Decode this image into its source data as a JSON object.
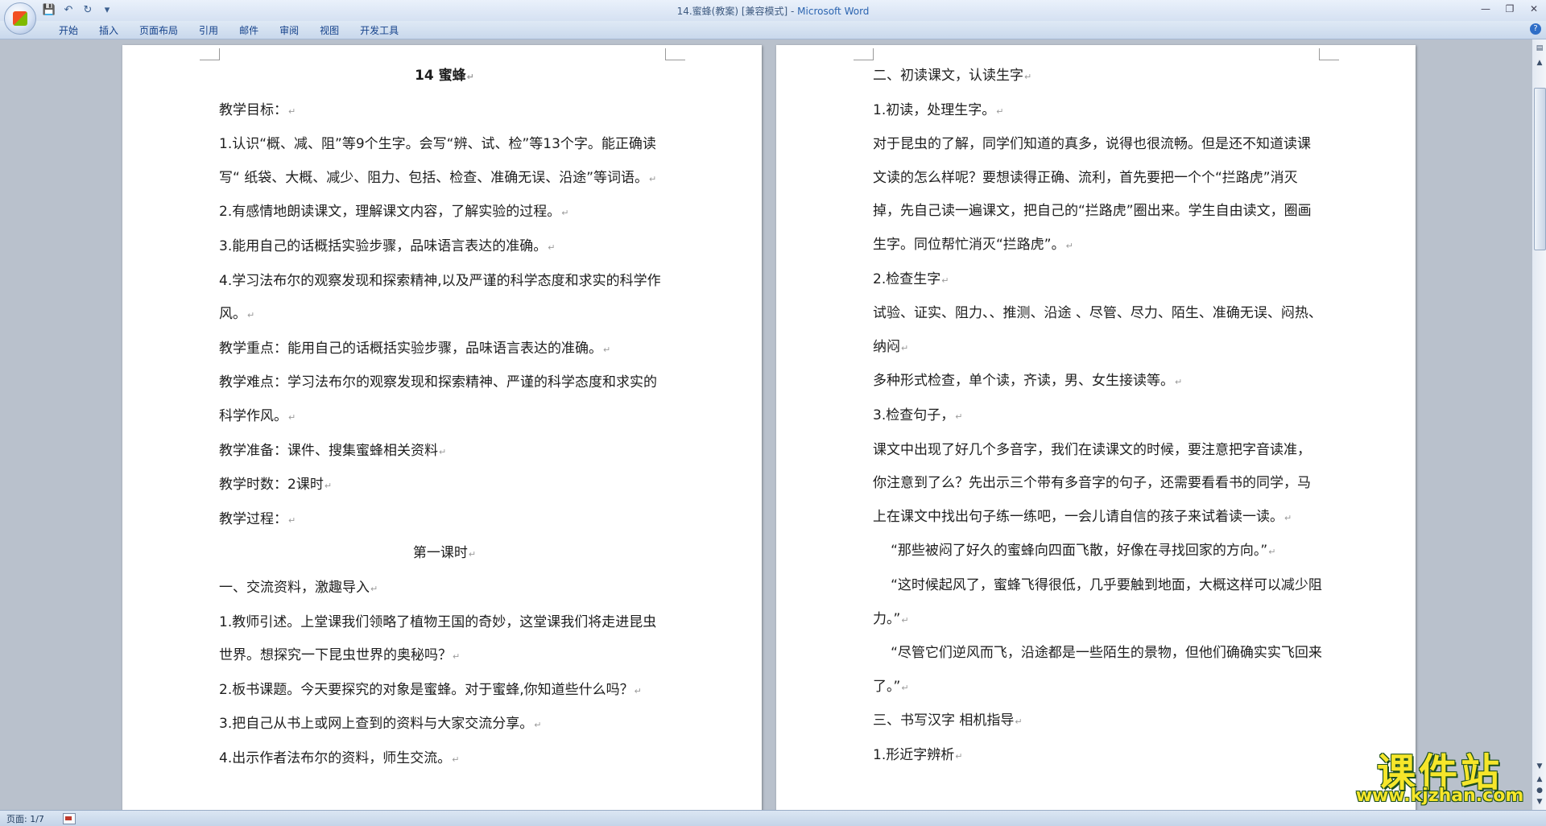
{
  "window": {
    "title_doc": "14.蜜蜂(教案) [兼容模式] - ",
    "title_app": "Microsoft Word"
  },
  "ribbon": {
    "tabs": [
      "开始",
      "插入",
      "页面布局",
      "引用",
      "邮件",
      "审阅",
      "视图",
      "开发工具"
    ]
  },
  "status": {
    "page": "页面: 1/7"
  },
  "watermark": {
    "name": "课件站",
    "url": "www.kjzhan.com"
  },
  "pages": [
    {
      "paragraphs": [
        {
          "text": "14 蜜蜂",
          "align": "center",
          "bold": true
        },
        {
          "text": "教学目标："
        },
        {
          "text": "1.认识“概、减、阻”等9个生字。会写“辨、试、检”等13个字。能正确读写“ 纸袋、大概、减少、阻力、包括、检查、准确无误、沿途”等词语。"
        },
        {
          "text": "2.有感情地朗读课文，理解课文内容，了解实验的过程。"
        },
        {
          "text": "3.能用自己的话概括实验步骤，品味语言表达的准确。"
        },
        {
          "text": "4.学习法布尔的观察发现和探索精神,以及严谨的科学态度和求实的科学作风。"
        },
        {
          "text": "教学重点：能用自己的话概括实验步骤，品味语言表达的准确。"
        },
        {
          "text": "教学难点：学习法布尔的观察发现和探索精神、严谨的科学态度和求实的科学作风。"
        },
        {
          "text": "教学准备：课件、搜集蜜蜂相关资料"
        },
        {
          "text": "教学时数：2课时"
        },
        {
          "text": "教学过程："
        },
        {
          "text": "第一课时",
          "align": "center"
        },
        {
          "text": "一、交流资料，激趣导入"
        },
        {
          "text": "1.教师引述。上堂课我们领略了植物王国的奇妙，这堂课我们将走进昆虫世界。想探究一下昆虫世界的奥秘吗？"
        },
        {
          "text": "2.板书课题。今天要探究的对象是蜜蜂。对于蜜蜂,你知道些什么吗？"
        },
        {
          "text": "3.把自己从书上或网上查到的资料与大家交流分享。"
        },
        {
          "text": "4.出示作者法布尔的资料，师生交流。"
        }
      ]
    },
    {
      "paragraphs": [
        {
          "text": "二、初读课文，认读生字"
        },
        {
          "text": "1.初读，处理生字。"
        },
        {
          "text": "对于昆虫的了解，同学们知道的真多，说得也很流畅。但是还不知道读课文读的怎么样呢？要想读得正确、流利，首先要把一个个“拦路虎”消灭掉，先自己读一遍课文，把自己的“拦路虎”圈出来。学生自由读文，圈画生字。同位帮忙消灭“拦路虎”。"
        },
        {
          "text": "2.检查生字"
        },
        {
          "text": "试验、证实、阻力、、推测、沿途 、尽管、尽力、陌生、准确无误、闷热、纳闷"
        },
        {
          "text": "多种形式检查，单个读，齐读，男、女生接读等。"
        },
        {
          "text": "3.检查句子，"
        },
        {
          "text": "课文中出现了好几个多音字，我们在读课文的时候，要注意把字音读准，你注意到了么？先出示三个带有多音字的句子，还需要看看书的同学，马上在课文中找出句子练一练吧，一会儿请自信的孩子来试着读一读。"
        },
        {
          "text": "“那些被闷了好久的蜜蜂向四面飞散，好像在寻找回家的方向。”",
          "indent": true
        },
        {
          "text": "“这时候起风了，蜜蜂飞得很低，几乎要触到地面，大概这样可以减少阻力。”",
          "indent": true
        },
        {
          "text": "“尽管它们逆风而飞，沿途都是一些陌生的景物，但他们确确实实飞回来了。”",
          "indent": true
        },
        {
          "text": "三、书写汉字 相机指导"
        },
        {
          "text": "1.形近字辨析"
        }
      ]
    }
  ]
}
